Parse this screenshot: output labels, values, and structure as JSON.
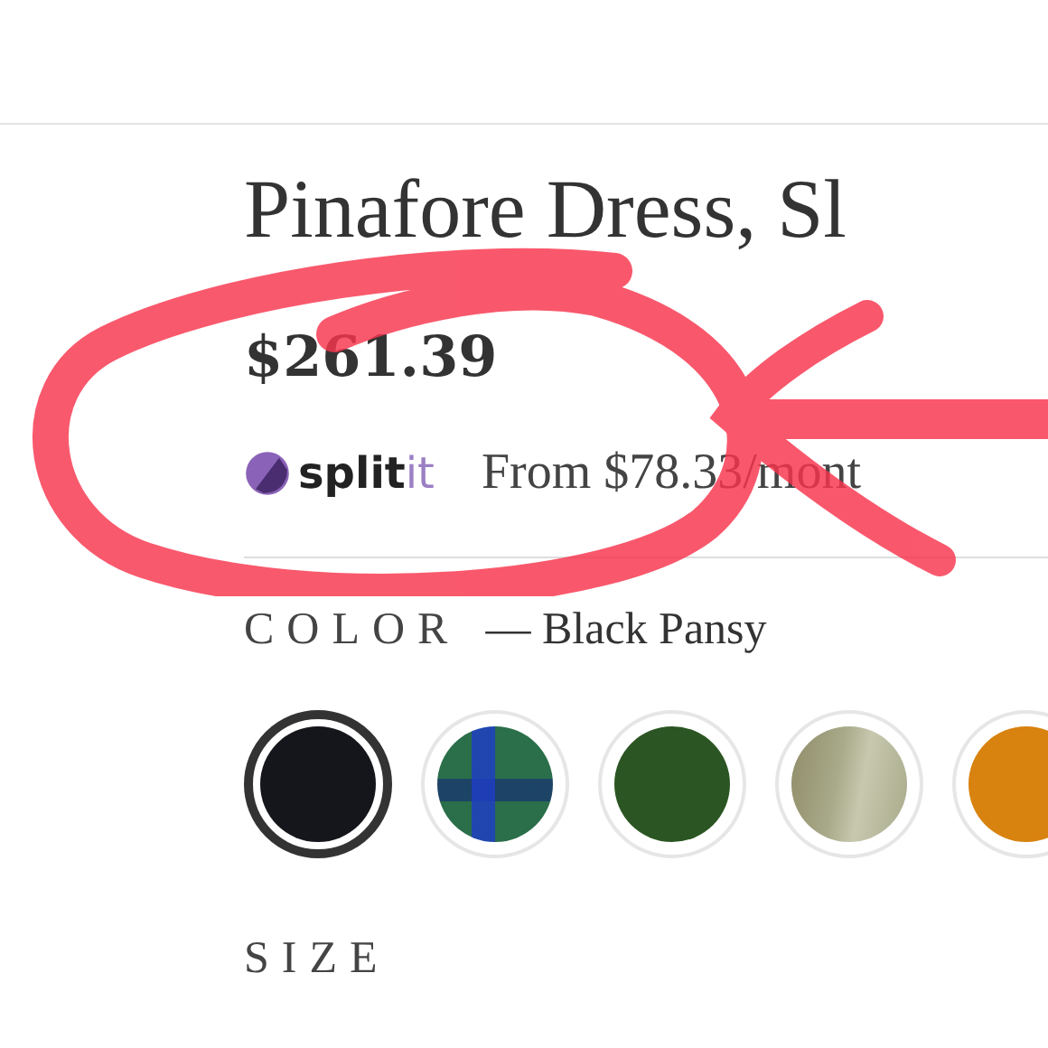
{
  "product": {
    "title": "Pinafore Dress, Sl",
    "price": "$261.39"
  },
  "installments": {
    "logo_bold": "split",
    "logo_light": "it",
    "text": "From $78.33/mont"
  },
  "color": {
    "label": "COLOR",
    "value": "— Black Pansy"
  },
  "swatches": [
    {
      "kind": "solid",
      "color": "#15161c",
      "selected": true
    },
    {
      "kind": "plaid",
      "color": "#2a6e4a",
      "selected": false
    },
    {
      "kind": "solid",
      "color": "#2b5522",
      "selected": false
    },
    {
      "kind": "texture",
      "color": "#a8aa8a",
      "selected": false
    },
    {
      "kind": "solid",
      "color": "#d8820f",
      "selected": false
    }
  ],
  "size": {
    "label": "SIZE"
  },
  "annotation": {
    "kind": "circle-arrow"
  }
}
